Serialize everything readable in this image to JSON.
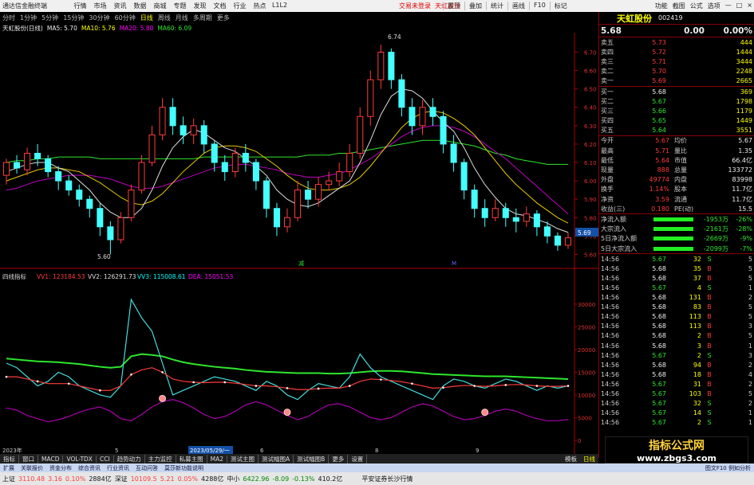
{
  "window": {
    "app_title": "通达信金融终端",
    "menus": [
      "行情",
      "市场",
      "资讯",
      "数据",
      "商城",
      "专题",
      "发现",
      "文档",
      "行业",
      "热点",
      "L1L2"
    ],
    "center_msg": "交易未登录",
    "center_stock": "天虹股份",
    "toolbar": [
      "置顶",
      "叠加",
      "统计",
      "画线",
      "F10",
      "标记"
    ],
    "window_controls": [
      "功能",
      "截图",
      "公式",
      "选项",
      "—",
      "□",
      "×"
    ]
  },
  "periods": [
    "分时",
    "1分钟",
    "5分钟",
    "15分钟",
    "30分钟",
    "60分钟",
    "日线",
    "周线",
    "月线",
    "多周期",
    "更多"
  ],
  "active_period": "日线",
  "chart_header": {
    "name": "天虹股份(日线)",
    "ma5": "MA5: 5.70",
    "ma10": "MA10: 5.76",
    "ma20": "MA20: 5.80",
    "ma60": "MA60: 6.09"
  },
  "price_axis": [
    "6.70",
    "6.60",
    "6.50",
    "6.40",
    "6.30",
    "6.20",
    "6.10",
    "6.00",
    "5.90",
    "5.80",
    "5.70",
    "5.60"
  ],
  "price_labels": {
    "high": "6.74",
    "low": "5.60",
    "current": "5.69"
  },
  "event_marks": [
    "减",
    "M"
  ],
  "indicator_header": {
    "name": "四线指标",
    "vv1": "VV1: 123184.53",
    "vv2": "VV2: 126291.73",
    "vv3": "VV3: 115008.61",
    "dea": "DEA: 15051.53"
  },
  "indicator_axis": [
    "30000",
    "25000",
    "20000",
    "15000",
    "10000",
    "5000",
    "0"
  ],
  "date_axis": {
    "year": "2023年",
    "m5": "5",
    "m6": "6",
    "m7": "7",
    "m8": "8",
    "m9": "9",
    "cursor_date": "2023/05/29/一"
  },
  "quote": {
    "name": "天虹股份",
    "code": "002419",
    "price": "5.68",
    "change": "0.00",
    "pct": "0.00%",
    "asks": [
      {
        "label": "卖五",
        "price": "5.73",
        "vol": "444"
      },
      {
        "label": "卖四",
        "price": "5.72",
        "vol": "1444"
      },
      {
        "label": "卖三",
        "price": "5.71",
        "vol": "3444"
      },
      {
        "label": "卖二",
        "price": "5.70",
        "vol": "2248"
      },
      {
        "label": "卖一",
        "price": "5.69",
        "vol": "2665"
      }
    ],
    "bids": [
      {
        "label": "买一",
        "price": "5.68",
        "vol": "369"
      },
      {
        "label": "买二",
        "price": "5.67",
        "vol": "1798"
      },
      {
        "label": "买三",
        "price": "5.66",
        "vol": "1179"
      },
      {
        "label": "买四",
        "price": "5.65",
        "vol": "1449"
      },
      {
        "label": "买五",
        "price": "5.64",
        "vol": "3551"
      }
    ],
    "stats": [
      {
        "l1": "今开",
        "v1": "5.67",
        "l2": "均价",
        "v2": "5.67"
      },
      {
        "l1": "最高",
        "v1": "5.71",
        "l2": "量比",
        "v2": "1.35"
      },
      {
        "l1": "最低",
        "v1": "5.64",
        "l2": "市值",
        "v2": "66.4亿"
      },
      {
        "l1": "现量",
        "v1": "888",
        "l2": "总量",
        "v2": "133772"
      },
      {
        "l1": "外盘",
        "v1": "49774",
        "l2": "内盘",
        "v2": "83998"
      },
      {
        "l1": "换手",
        "v1": "1.14%",
        "l2": "股本",
        "v2": "11.7亿"
      },
      {
        "l1": "净资",
        "v1": "3.59",
        "l2": "流通",
        "v2": "11.7亿"
      },
      {
        "l1": "收益(三)",
        "v1": "0.180",
        "l2": "PE(动)",
        "v2": "15.5"
      }
    ],
    "flows": [
      {
        "label": "净流入额",
        "val": "-1953万",
        "pct": "-26%"
      },
      {
        "label": "大宗流入",
        "val": "-2161万",
        "pct": "-28%"
      },
      {
        "label": "5日净流入额",
        "val": "-2669万",
        "pct": "-9%"
      },
      {
        "label": "5日大宗流入",
        "val": "-2099万",
        "pct": "-7%"
      }
    ],
    "ticks": [
      [
        "14:56",
        "5.67",
        "32",
        "S",
        "5"
      ],
      [
        "14:56",
        "5.68",
        "35",
        "B",
        "5"
      ],
      [
        "14:56",
        "5.68",
        "37",
        "B",
        "5"
      ],
      [
        "14:56",
        "5.67",
        "4",
        "S",
        "1"
      ],
      [
        "14:56",
        "5.68",
        "131",
        "B",
        "2"
      ],
      [
        "14:56",
        "5.68",
        "83",
        "B",
        "5"
      ],
      [
        "14:56",
        "5.68",
        "113",
        "B",
        "5"
      ],
      [
        "14:56",
        "5.68",
        "113",
        "B",
        "3"
      ],
      [
        "14:56",
        "5.68",
        "2",
        "B",
        "5"
      ],
      [
        "14:56",
        "5.68",
        "3",
        "B",
        "1"
      ],
      [
        "14:56",
        "5.67",
        "2",
        "S",
        "3"
      ],
      [
        "14:56",
        "5.68",
        "94",
        "B",
        "2"
      ],
      [
        "14:56",
        "5.68",
        "18",
        "B",
        "4"
      ],
      [
        "14:56",
        "5.67",
        "31",
        "B",
        "2"
      ],
      [
        "14:56",
        "5.67",
        "103",
        "B",
        "5"
      ],
      [
        "14:56",
        "5.67",
        "32",
        "S",
        "2"
      ],
      [
        "14:56",
        "5.67",
        "14",
        "S",
        "1"
      ],
      [
        "14:56",
        "5.67",
        "2",
        "S",
        "1"
      ]
    ]
  },
  "bottom_tabs": [
    "指标",
    "窗口",
    "MACD",
    "VOL-TDX",
    "CCI",
    "趋势动力",
    "主力监控",
    "私募主图",
    "MA2",
    "测试主图",
    "测试幅图A",
    "测试幅图B",
    "更多",
    "设置"
  ],
  "bottom_tabs2": [
    "扩展",
    "关联报价",
    "资金分布",
    "综合资讯",
    "行业资讯",
    "互动问答",
    "莫莎新功能说明"
  ],
  "right_tab": "日线",
  "mode_label": "模板",
  "status": {
    "items": [
      {
        "name": "上证",
        "val": "3110.48",
        "chg": "3.16",
        "pct": "0.10%",
        "amt": "2884亿"
      },
      {
        "name": "深证",
        "val": "10109.5",
        "chg": "5.21",
        "pct": "0.05%",
        "amt": "4288亿"
      },
      {
        "name": "中小",
        "val": "6422.96",
        "chg": "-8.09",
        "pct": "-0.13%",
        "amt": "410.2亿"
      }
    ],
    "broker": "平安证券长沙行情",
    "f10": "图文F10 例如分析"
  },
  "watermark": {
    "line1": "指标公式网",
    "line2": "www.zbgs3.com"
  },
  "chart_data": {
    "type": "line",
    "note_series": [
      "candles",
      "MA5",
      "MA10",
      "MA20",
      "MA60"
    ],
    "ylim": [
      5.55,
      6.78
    ],
    "candles": [
      [
        6.03,
        6.1,
        6.12,
        5.98
      ],
      [
        6.1,
        6.07,
        6.14,
        6.04
      ],
      [
        6.06,
        6.15,
        6.18,
        6.03
      ],
      [
        6.15,
        6.12,
        6.2,
        6.08
      ],
      [
        6.12,
        6.05,
        6.14,
        6.02
      ],
      [
        6.05,
        6.0,
        6.08,
        5.95
      ],
      [
        6.0,
        5.95,
        6.03,
        5.92
      ],
      [
        5.95,
        5.9,
        5.98,
        5.86
      ],
      [
        5.9,
        5.85,
        5.92,
        5.8
      ],
      [
        5.85,
        5.75,
        5.88,
        5.7
      ],
      [
        5.75,
        5.68,
        5.78,
        5.6
      ],
      [
        5.68,
        5.8,
        5.83,
        5.66
      ],
      [
        5.8,
        5.95,
        5.98,
        5.78
      ],
      [
        5.95,
        6.1,
        6.14,
        5.93
      ],
      [
        6.1,
        6.25,
        6.3,
        6.08
      ],
      [
        6.25,
        6.4,
        6.45,
        6.22
      ],
      [
        6.4,
        6.3,
        6.45,
        6.25
      ],
      [
        6.3,
        6.25,
        6.35,
        6.2
      ],
      [
        6.25,
        6.3,
        6.34,
        6.2
      ],
      [
        6.3,
        6.2,
        6.33,
        6.15
      ],
      [
        6.2,
        6.1,
        6.22,
        6.05
      ],
      [
        6.1,
        6.05,
        6.14,
        6.0
      ],
      [
        6.05,
        6.15,
        6.18,
        6.02
      ],
      [
        6.15,
        6.1,
        6.2,
        6.05
      ],
      [
        6.1,
        6.0,
        6.12,
        5.95
      ],
      [
        6.0,
        5.85,
        6.02,
        5.8
      ],
      [
        5.85,
        5.75,
        5.88,
        5.7
      ],
      [
        5.75,
        5.8,
        5.85,
        5.72
      ],
      [
        5.8,
        5.95,
        6.0,
        5.78
      ],
      [
        5.95,
        5.9,
        6.0,
        5.85
      ],
      [
        5.9,
        5.98,
        6.02,
        5.86
      ],
      [
        5.98,
        6.0,
        6.05,
        5.95
      ],
      [
        6.0,
        6.05,
        6.1,
        5.97
      ],
      [
        6.05,
        6.15,
        6.2,
        6.02
      ],
      [
        6.15,
        6.35,
        6.4,
        6.12
      ],
      [
        6.35,
        6.55,
        6.6,
        6.3
      ],
      [
        6.55,
        6.7,
        6.74,
        6.5
      ],
      [
        6.7,
        6.55,
        6.72,
        6.5
      ],
      [
        6.55,
        6.4,
        6.58,
        6.35
      ],
      [
        6.4,
        6.3,
        6.45,
        6.25
      ],
      [
        6.3,
        6.4,
        6.44,
        6.25
      ],
      [
        6.4,
        6.35,
        6.45,
        6.3
      ],
      [
        6.35,
        6.2,
        6.38,
        6.15
      ],
      [
        6.2,
        6.1,
        6.25,
        6.05
      ],
      [
        6.1,
        5.95,
        6.12,
        5.9
      ],
      [
        5.95,
        5.85,
        5.98,
        5.8
      ],
      [
        5.85,
        5.8,
        5.9,
        5.75
      ],
      [
        5.8,
        5.85,
        5.9,
        5.78
      ],
      [
        5.85,
        5.8,
        5.88,
        5.75
      ],
      [
        5.8,
        5.78,
        5.85,
        5.72
      ],
      [
        5.78,
        5.82,
        5.86,
        5.75
      ],
      [
        5.82,
        5.75,
        5.84,
        5.7
      ],
      [
        5.75,
        5.7,
        5.78,
        5.66
      ],
      [
        5.7,
        5.65,
        5.72,
        5.62
      ],
      [
        5.65,
        5.69,
        5.72,
        5.63
      ]
    ],
    "ma5": [
      6.05,
      6.07,
      6.09,
      6.1,
      6.1,
      6.07,
      6.05,
      6.0,
      5.95,
      5.88,
      5.83,
      5.8,
      5.8,
      5.85,
      5.95,
      6.08,
      6.18,
      6.24,
      6.28,
      6.26,
      6.22,
      6.18,
      6.16,
      6.12,
      6.08,
      6.03,
      5.95,
      5.9,
      5.87,
      5.86,
      5.88,
      5.92,
      5.96,
      6.0,
      6.1,
      6.22,
      6.36,
      6.46,
      6.5,
      6.49,
      6.45,
      6.38,
      6.32,
      6.27,
      6.18,
      6.07,
      5.98,
      5.91,
      5.85,
      5.82,
      5.81,
      5.79,
      5.77,
      5.74,
      5.72
    ],
    "ma10": [
      6.0,
      6.02,
      6.04,
      6.06,
      6.07,
      6.07,
      6.06,
      6.05,
      6.02,
      5.99,
      5.95,
      5.91,
      5.88,
      5.87,
      5.89,
      5.93,
      5.99,
      6.05,
      6.1,
      6.15,
      6.18,
      6.19,
      6.19,
      6.18,
      6.16,
      6.12,
      6.08,
      6.03,
      5.99,
      5.96,
      5.95,
      5.95,
      5.96,
      5.98,
      6.02,
      6.08,
      6.15,
      6.22,
      6.29,
      6.34,
      6.37,
      6.38,
      6.37,
      6.34,
      6.3,
      6.25,
      6.18,
      6.11,
      6.04,
      5.98,
      5.93,
      5.88,
      5.84,
      5.8,
      5.77
    ],
    "ma20": [
      5.95,
      5.96,
      5.98,
      6.0,
      6.01,
      6.02,
      6.03,
      6.03,
      6.03,
      6.02,
      6.01,
      5.99,
      5.97,
      5.96,
      5.96,
      5.97,
      5.99,
      6.01,
      6.03,
      6.05,
      6.07,
      6.08,
      6.09,
      6.09,
      6.08,
      6.07,
      6.06,
      6.04,
      6.03,
      6.02,
      6.02,
      6.03,
      6.04,
      6.06,
      6.09,
      6.12,
      6.16,
      6.2,
      6.24,
      6.27,
      6.29,
      6.3,
      6.3,
      6.29,
      6.27,
      6.24,
      6.2,
      6.16,
      6.12,
      6.07,
      6.02,
      5.97,
      5.92,
      5.87,
      5.82
    ],
    "ma60": [
      6.1,
      6.11,
      6.11,
      6.12,
      6.12,
      6.13,
      6.13,
      6.13,
      6.13,
      6.12,
      6.12,
      6.12,
      6.12,
      6.12,
      6.12,
      6.12,
      6.12,
      6.12,
      6.12,
      6.13,
      6.13,
      6.13,
      6.13,
      6.13,
      6.13,
      6.13,
      6.13,
      6.13,
      6.13,
      6.14,
      6.14,
      6.14,
      6.15,
      6.15,
      6.16,
      6.17,
      6.18,
      6.19,
      6.2,
      6.21,
      6.22,
      6.22,
      6.22,
      6.21,
      6.2,
      6.19,
      6.17,
      6.15,
      6.14,
      6.12,
      6.11,
      6.1,
      6.09,
      6.09,
      6.09
    ],
    "indicator": {
      "ylim": [
        0,
        34000
      ],
      "vv1": [
        17000,
        16000,
        14000,
        12000,
        13000,
        15000,
        14000,
        12000,
        11000,
        10000,
        9500,
        12000,
        31000,
        27000,
        24000,
        17000,
        10000,
        11000,
        12000,
        13000,
        14000,
        13500,
        13000,
        12000,
        11000,
        13000,
        12000,
        10000,
        9000,
        11000,
        12500,
        12000,
        11500,
        14000,
        19000,
        16000,
        14000,
        13000,
        12000,
        11000,
        10000,
        9000,
        12000,
        13500,
        13000,
        12000,
        11500,
        12500,
        13500,
        13000,
        12000,
        11000,
        12000,
        11500,
        12000
      ],
      "vv2": [
        14000,
        14000,
        13500,
        13000,
        12500,
        12500,
        12500,
        12000,
        11500,
        11000,
        11000,
        12000,
        14500,
        15500,
        16000,
        15000,
        13500,
        13000,
        12800,
        12700,
        12800,
        12800,
        12600,
        12300,
        12000,
        12000,
        11800,
        11500,
        11200,
        11200,
        11400,
        11500,
        11500,
        12000,
        13000,
        13500,
        13400,
        13200,
        12900,
        12500,
        12000,
        11500,
        11600,
        11900,
        12100,
        12000,
        11900,
        12000,
        12200,
        12300,
        12200,
        12000,
        11900,
        11900,
        12000
      ],
      "vv3": [
        18000,
        17800,
        17600,
        17400,
        17300,
        17200,
        17000,
        16800,
        16500,
        16200,
        16000,
        16200,
        18500,
        19000,
        18800,
        18500,
        17800,
        17200,
        16800,
        16500,
        16200,
        16000,
        15800,
        15500,
        15300,
        15100,
        15000,
        14900,
        14800,
        14800,
        14800,
        14700,
        14700,
        14800,
        15000,
        15200,
        15300,
        15300,
        15200,
        15000,
        14800,
        14600,
        14500,
        14400,
        14300,
        14200,
        14100,
        14100,
        14100,
        14000,
        13900,
        13800,
        13700,
        13600,
        13500
      ],
      "dea": [
        2000,
        1800,
        1300,
        1000,
        700,
        900,
        1200,
        1600,
        1900,
        2100,
        1700,
        1000,
        800,
        1400,
        2100,
        2600,
        2800,
        2500,
        2000,
        1400,
        1000,
        1200,
        1700,
        2300,
        2600,
        2300,
        1800,
        1300,
        900,
        1200,
        1800,
        2300,
        2400,
        2100,
        1600,
        1100,
        900,
        1100,
        1600,
        2100,
        2400,
        2200,
        1700,
        1200,
        900,
        1000,
        1300,
        1700,
        1900,
        1700,
        1300,
        1000,
        800,
        800,
        900
      ],
      "dots_at": [
        15,
        27,
        46
      ]
    }
  }
}
